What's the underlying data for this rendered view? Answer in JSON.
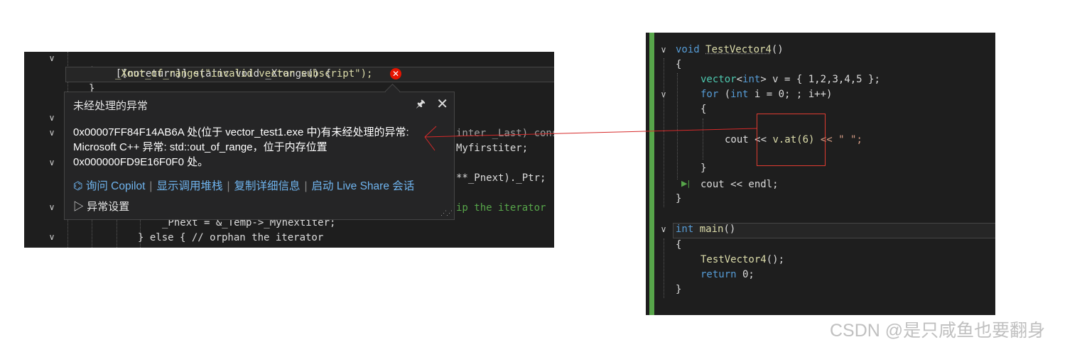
{
  "left_editor": {
    "lines": [
      {
        "text": "[[noreturn]] static void _Xrange() {"
      },
      {
        "text": "_Xout_of_range(\"invalid vector subscript\");"
      },
      {
        "text": "}"
      },
      {
        "text": "inter _Last) cons"
      },
      {
        "text": "Myfirstiter;"
      },
      {
        "text": "**_Pnext)._Ptr;"
      },
      {
        "text": "ip the iterator"
      },
      {
        "text": "_Pnext = &_Temp->_Mynextiter;"
      },
      {
        "text": "} else { // orphan the iterator"
      }
    ]
  },
  "exception_popup": {
    "title": "未经处理的异常",
    "message_line1": "0x00007FF84F14AB6A 处(位于 vector_test1.exe 中)有未经处理的异常:",
    "message_line2": "Microsoft C++ 异常: std::out_of_range，位于内存位置",
    "message_line3": "0x000000FD9E16F0F0 处。",
    "links": {
      "ask_copilot": "询问 Copilot",
      "show_call_stack": "显示调用堆栈",
      "copy_details": "复制详细信息",
      "live_share": "启动 Live Share 会话"
    },
    "exception_settings": "异常设置",
    "pin_icon": "pin-icon",
    "close_icon": "close-icon"
  },
  "right_editor": {
    "l1_kw": "void",
    "l1_fn": "TestVector4",
    "l1_rest": "()",
    "l2": "{",
    "l3_a": "vector",
    "l3_b": "<",
    "l3_c": "int",
    "l3_d": "> v = { 1,2,3,4,5 };",
    "l4_a": "for",
    "l4_b": " (",
    "l4_c": "int",
    "l4_d": " i = 0; ; i++)",
    "l5": "{",
    "l6_a": "cout << ",
    "l6_b": "v.at(6)",
    "l6_c": " << \" \";",
    "l7": "}",
    "l8": "cout << endl;",
    "l9": "}",
    "l10_kw": "int",
    "l10_fn": "main",
    "l10_rest": "()",
    "l11": "{",
    "l12_fn": "TestVector4",
    "l12_rest": "();",
    "l13_kw": "return",
    "l13_rest": " 0;",
    "l14": "}"
  },
  "watermark": "CSDN @是只咸鱼也要翻身",
  "colors": {
    "accent_green": "#57a64a",
    "error_red": "#e51400",
    "annotation_red": "#e03c31",
    "link_blue": "#6fb4ee"
  }
}
